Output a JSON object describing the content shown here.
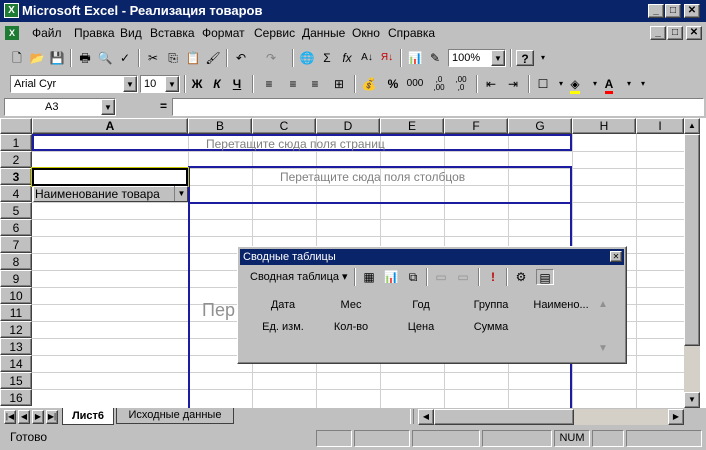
{
  "window": {
    "title": "Microsoft Excel - Реализация товаров",
    "minimize": "_",
    "maximize": "□",
    "close": "✕"
  },
  "menu": [
    "Файл",
    "Правка",
    "Вид",
    "Вставка",
    "Формат",
    "Сервис",
    "Данные",
    "Окно",
    "Справка"
  ],
  "standard_toolbar": {
    "zoom": "100%",
    "help": "?"
  },
  "format_toolbar": {
    "font": "Arial Cyr",
    "size": "10",
    "bold": "Ж",
    "italic": "К",
    "underline": "Ч",
    "percent": "%",
    "thousands": "000",
    "inc_decimals": ",0\n,00",
    "dec_decimals": ",00\n,0"
  },
  "formula_bar": {
    "name_box": "A3",
    "equals": "="
  },
  "columns": [
    "A",
    "B",
    "C",
    "D",
    "E",
    "F",
    "G",
    "H",
    "I"
  ],
  "rows": [
    "1",
    "2",
    "3",
    "4",
    "5",
    "6",
    "7",
    "8",
    "9",
    "10",
    "11",
    "12",
    "13",
    "14",
    "15",
    "16"
  ],
  "pivot_area": {
    "page_fields": "Перетащите сюда поля страниц",
    "column_fields": "Перетащите сюда поля столбцов",
    "row_field": "Наименование товара",
    "data_partial": "Пер"
  },
  "sheet_tabs": [
    "Лист6",
    "Исходные данные"
  ],
  "status": {
    "text": "Готово",
    "num": "NUM"
  },
  "pivot_toolbar": {
    "title": "Сводные таблицы",
    "menu": "Сводная таблица",
    "fields_row1": [
      "Дата",
      "Мес",
      "Год",
      "Группа",
      "Наимено..."
    ],
    "fields_row2": [
      "Ед. изм.",
      "Кол-во",
      "Цена",
      "Сумма"
    ]
  }
}
